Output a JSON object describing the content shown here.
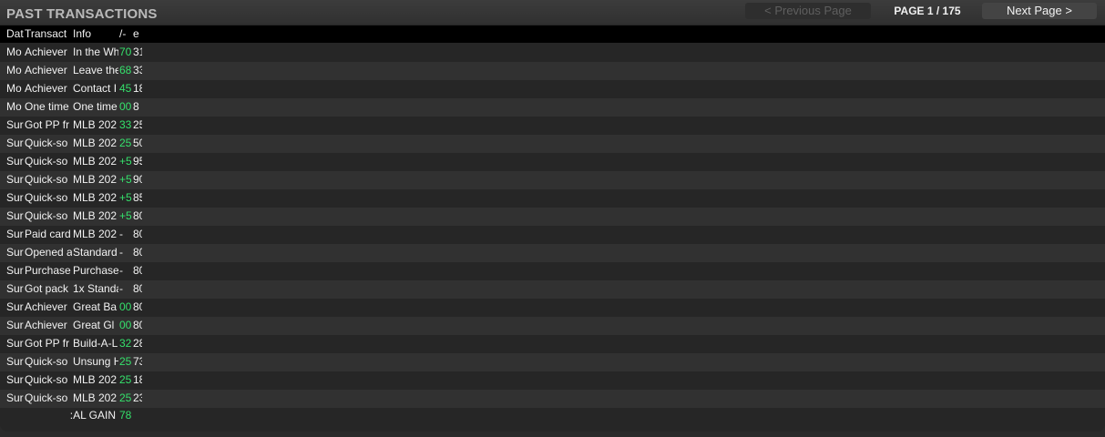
{
  "header": {
    "title": "PAST TRANSACTIONS",
    "prev_label": "< Previous Page",
    "page_indicator": "PAGE 1 / 175",
    "next_label": "Next Page >"
  },
  "columns": {
    "date": "Dat",
    "transaction": "Transact",
    "info": "Info",
    "delta": "/-",
    "balance": "e"
  },
  "rows": [
    {
      "date": "Mo",
      "transaction": "Achiever",
      "info": "In the Wh",
      "delta": "70",
      "balance": "31",
      "positive": true
    },
    {
      "date": "Mo",
      "transaction": "Achiever",
      "info": "Leave the",
      "delta": "68",
      "balance": "33",
      "positive": true
    },
    {
      "date": "Mo",
      "transaction": "Achiever",
      "info": "Contact I",
      "delta": "45",
      "balance": "18",
      "positive": true
    },
    {
      "date": "Mo",
      "transaction": "One time",
      "info": "One time",
      "delta": "00",
      "balance": "8",
      "positive": true
    },
    {
      "date": "Sur",
      "transaction": "Got PP fr",
      "info": "MLB 202",
      "delta": "33",
      "balance": "25",
      "positive": true
    },
    {
      "date": "Sur",
      "transaction": "Quick-so",
      "info": "MLB 202",
      "delta": "25",
      "balance": "50",
      "positive": true
    },
    {
      "date": "Sur",
      "transaction": "Quick-so",
      "info": "MLB 202",
      "delta": "+5",
      "balance": "95",
      "positive": true
    },
    {
      "date": "Sur",
      "transaction": "Quick-so",
      "info": "MLB 202",
      "delta": "+5",
      "balance": "90",
      "positive": true
    },
    {
      "date": "Sur",
      "transaction": "Quick-so",
      "info": "MLB 202",
      "delta": "+5",
      "balance": "85",
      "positive": true
    },
    {
      "date": "Sur",
      "transaction": "Quick-so",
      "info": "MLB 202",
      "delta": "+5",
      "balance": "80",
      "positive": true
    },
    {
      "date": "Sur",
      "transaction": "Paid card",
      "info": "MLB 202",
      "delta": "-",
      "balance": "80",
      "positive": false
    },
    {
      "date": "Sur",
      "transaction": "Opened a",
      "info": "Standard",
      "delta": "-",
      "balance": "80",
      "positive": false
    },
    {
      "date": "Sur",
      "transaction": "Purchase",
      "info": "Purchase",
      "delta": "-",
      "balance": "80",
      "positive": false
    },
    {
      "date": "Sur",
      "transaction": "Got pack",
      "info": "1x Standa",
      "delta": "-",
      "balance": "80",
      "positive": false
    },
    {
      "date": "Sur",
      "transaction": "Achiever",
      "info": "Great Ba",
      "delta": "00",
      "balance": "80",
      "positive": true
    },
    {
      "date": "Sur",
      "transaction": "Achiever",
      "info": "Great Gl",
      "delta": "00",
      "balance": "80",
      "positive": true
    },
    {
      "date": "Sur",
      "transaction": "Got PP fr",
      "info": "Build-A-L",
      "delta": "32",
      "balance": "28",
      "positive": true
    },
    {
      "date": "Sur",
      "transaction": "Quick-so",
      "info": "Unsung H",
      "delta": "25",
      "balance": "73",
      "positive": true
    },
    {
      "date": "Sur",
      "transaction": "Quick-so",
      "info": "MLB 202",
      "delta": "25",
      "balance": "18",
      "positive": true
    },
    {
      "date": "Sur",
      "transaction": "Quick-so",
      "info": "MLB 202",
      "delta": "25",
      "balance": "23",
      "positive": true
    }
  ],
  "total": {
    "label": "AL GAIN:",
    "value": "78"
  },
  "colors": {
    "positive": "#35e06b",
    "text": "#f2f2f2",
    "title": "#b9b9b9"
  }
}
